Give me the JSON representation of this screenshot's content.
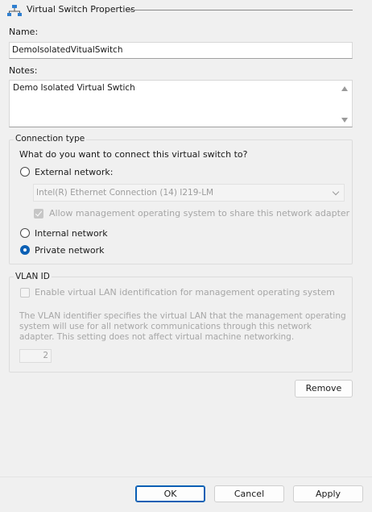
{
  "header": {
    "title": "Virtual Switch Properties",
    "icon": "network-switch-icon"
  },
  "name": {
    "label": "Name:",
    "value": "DemoIsolatedVitualSwitch"
  },
  "notes": {
    "label": "Notes:",
    "value": "Demo Isolated Virtual Swtich"
  },
  "connection": {
    "legend": "Connection type",
    "question": "What do you want to connect this virtual switch to?",
    "external_label": "External network:",
    "adapter_selected": "Intel(R) Ethernet Connection (14) I219-LM",
    "allow_mgmt_label": "Allow management operating system to share this network adapter",
    "allow_mgmt_checked": true,
    "internal_label": "Internal network",
    "private_label": "Private network",
    "selected": "private"
  },
  "vlan": {
    "legend": "VLAN ID",
    "enable_label": "Enable virtual LAN identification for management operating system",
    "enable_checked": false,
    "description": "The VLAN identifier specifies the virtual LAN that the management operating system will use for all network communications through this network adapter. This setting does not affect virtual machine networking.",
    "id_value": "2"
  },
  "buttons": {
    "remove": "Remove",
    "ok": "OK",
    "cancel": "Cancel",
    "apply": "Apply"
  },
  "colors": {
    "accent": "#0a5fb4",
    "background": "#f0f0f0",
    "disabled_text": "#a6a6a6"
  }
}
